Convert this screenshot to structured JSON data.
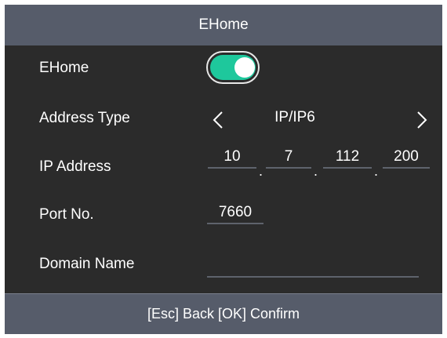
{
  "header": {
    "title": "EHome"
  },
  "form": {
    "ehome": {
      "label": "EHome",
      "enabled": true,
      "accent_color": "#1ec89c"
    },
    "address_type": {
      "label": "Address Type",
      "value": "IP/IP6",
      "prev_icon": "chevron-left",
      "next_icon": "chevron-right"
    },
    "ip_address": {
      "label": "IP Address",
      "octets": [
        "10",
        "7",
        "112",
        "200"
      ],
      "separator": "."
    },
    "port": {
      "label": "Port No.",
      "value": "7660"
    },
    "domain": {
      "label": "Domain Name",
      "value": ""
    }
  },
  "footer": {
    "hint": "[Esc] Back [OK] Confirm"
  }
}
